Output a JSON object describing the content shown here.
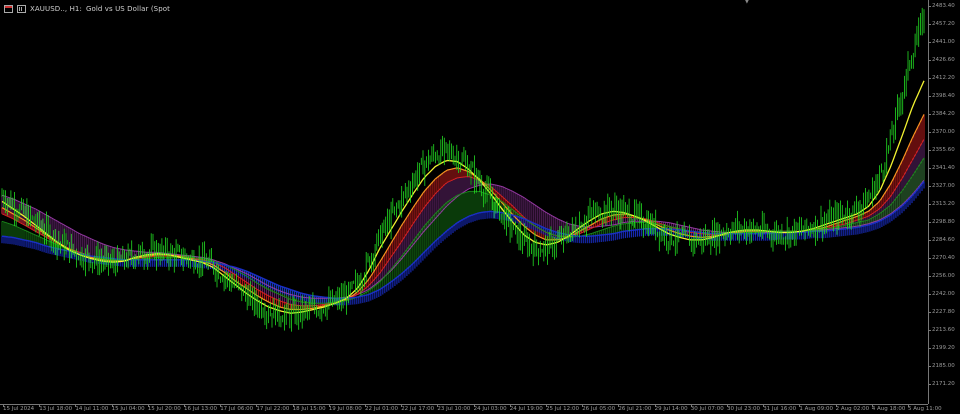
{
  "title": {
    "symbol": "XAUUSD.., H1:",
    "description": "Gold vs US Dollar (Spot"
  },
  "icons": {
    "window": "window-menu-icon",
    "chart_type": "bar-chart-icon",
    "corner": "triangle-marker-icon"
  },
  "colors": {
    "background": "#000000",
    "candles": "#22dd22",
    "ma_fast": "#ffff33",
    "ma_orange": "#ff9922",
    "ma_red": "#dd2222",
    "ma_green": "#1a8a1a",
    "ma_blue": "#1a2fcc",
    "ma_purple": "#9a3aa8"
  },
  "price_axis": {
    "labels": [
      "2483.40",
      "2457.20",
      "2441.00",
      "2426.60",
      "2412.20",
      "2398.40",
      "2384.20",
      "2370.00",
      "2355.60",
      "2341.40",
      "2327.00",
      "2313.20",
      "2298.80",
      "2284.60",
      "2270.40",
      "2256.00",
      "2242.00",
      "2227.80",
      "2213.60",
      "2199.20",
      "2185.00",
      "2171.20"
    ]
  },
  "time_axis": {
    "labels": [
      "15 Jul 2024",
      "13 Jul 18:00",
      "14 Jul 11:00",
      "15 Jul 04:00",
      "15 Jul 20:00",
      "16 Jul 13:00",
      "17 Jul 06:00",
      "17 Jul 22:00",
      "18 Jul 15:00",
      "19 Jul 08:00",
      "22 Jul 01:00",
      "22 Jul 17:00",
      "23 Jul 10:00",
      "24 Jul 03:00",
      "24 Jul 19:00",
      "25 Jul 12:00",
      "26 Jul 05:00",
      "26 Jul 21:00",
      "29 Jul 14:00",
      "30 Jul 07:00",
      "30 Jul 23:00",
      "31 Jul 16:00",
      "1 Aug 09:00",
      "2 Aug 02:00",
      "4 Aug 18:00",
      "5 Aug 11:00"
    ]
  },
  "chart_data": {
    "type": "line",
    "series": [
      {
        "key": "price",
        "values": [
          2333,
          2325,
          2318,
          2311,
          2304,
          2296,
          2290,
          2285,
          2282,
          2280,
          2278,
          2281,
          2285,
          2287,
          2288,
          2286,
          2284,
          2282,
          2280,
          2276,
          2268,
          2260,
          2252,
          2245,
          2240,
          2237,
          2236,
          2238,
          2241,
          2244,
          2247,
          2252,
          2262,
          2280,
          2300,
          2315,
          2330,
          2345,
          2358,
          2366,
          2368,
          2364,
          2355,
          2343,
          2330,
          2317,
          2305,
          2295,
          2290,
          2291,
          2295,
          2302,
          2310,
          2317,
          2321,
          2322,
          2320,
          2316,
          2311,
          2305,
          2300,
          2297,
          2296,
          2297,
          2300,
          2304,
          2306,
          2306,
          2305,
          2303,
          2302,
          2303,
          2305,
          2308,
          2312,
          2315,
          2318,
          2322,
          2330,
          2348,
          2378,
          2415,
          2450,
          2476
        ]
      },
      {
        "key": "ma_fast",
        "values": [
          2328,
          2322,
          2316,
          2309,
          2302,
          2295,
          2289,
          2285,
          2282,
          2280,
          2279,
          2280,
          2283,
          2285,
          2286,
          2285,
          2283,
          2281,
          2279,
          2275,
          2268,
          2261,
          2254,
          2248,
          2243,
          2240,
          2238,
          2239,
          2241,
          2243,
          2246,
          2250,
          2258,
          2272,
          2290,
          2305,
          2320,
          2334,
          2347,
          2356,
          2361,
          2360,
          2354,
          2345,
          2334,
          2322,
          2311,
          2301,
          2295,
          2293,
          2295,
          2300,
          2307,
          2313,
          2318,
          2320,
          2319,
          2316,
          2312,
          2307,
          2302,
          2299,
          2297,
          2297,
          2299,
          2302,
          2304,
          2305,
          2305,
          2304,
          2303,
          2303,
          2304,
          2306,
          2309,
          2312,
          2315,
          2318,
          2324,
          2336,
          2356,
          2380,
          2405,
          2425
        ]
      },
      {
        "key": "ma_orange",
        "values": [
          2323,
          2318,
          2313,
          2307,
          2301,
          2295,
          2290,
          2286,
          2283,
          2281,
          2280,
          2280,
          2282,
          2284,
          2285,
          2285,
          2284,
          2282,
          2280,
          2277,
          2271,
          2264,
          2258,
          2252,
          2247,
          2243,
          2241,
          2241,
          2242,
          2244,
          2246,
          2249,
          2255,
          2265,
          2279,
          2294,
          2309,
          2323,
          2336,
          2346,
          2353,
          2355,
          2352,
          2346,
          2337,
          2327,
          2317,
          2308,
          2301,
          2297,
          2297,
          2299,
          2304,
          2309,
          2314,
          2317,
          2318,
          2316,
          2313,
          2309,
          2305,
          2302,
          2300,
          2299,
          2300,
          2301,
          2303,
          2304,
          2304,
          2304,
          2303,
          2303,
          2304,
          2305,
          2307,
          2310,
          2313,
          2316,
          2320,
          2328,
          2342,
          2360,
          2380,
          2398
        ]
      },
      {
        "key": "ma_red",
        "values": [
          2318,
          2314,
          2309,
          2304,
          2299,
          2294,
          2290,
          2287,
          2284,
          2282,
          2281,
          2281,
          2282,
          2283,
          2284,
          2284,
          2284,
          2283,
          2281,
          2279,
          2275,
          2269,
          2263,
          2257,
          2252,
          2248,
          2245,
          2244,
          2244,
          2245,
          2247,
          2249,
          2253,
          2260,
          2270,
          2283,
          2296,
          2310,
          2323,
          2334,
          2343,
          2347,
          2348,
          2345,
          2340,
          2332,
          2324,
          2315,
          2308,
          2303,
          2300,
          2300,
          2302,
          2306,
          2310,
          2313,
          2315,
          2315,
          2314,
          2311,
          2308,
          2305,
          2303,
          2302,
          2301,
          2302,
          2303,
          2304,
          2304,
          2304,
          2304,
          2304,
          2304,
          2305,
          2306,
          2308,
          2310,
          2313,
          2316,
          2322,
          2332,
          2346,
          2362,
          2378
        ]
      },
      {
        "key": "ma_green",
        "values": [
          2312,
          2309,
          2305,
          2301,
          2297,
          2293,
          2289,
          2286,
          2284,
          2282,
          2281,
          2281,
          2281,
          2282,
          2283,
          2283,
          2283,
          2283,
          2282,
          2280,
          2277,
          2273,
          2268,
          2262,
          2257,
          2253,
          2249,
          2247,
          2246,
          2246,
          2247,
          2248,
          2251,
          2256,
          2263,
          2273,
          2284,
          2296,
          2308,
          2318,
          2327,
          2333,
          2336,
          2336,
          2333,
          2328,
          2321,
          2314,
          2308,
          2303,
          2300,
          2299,
          2300,
          2302,
          2305,
          2308,
          2310,
          2311,
          2311,
          2310,
          2308,
          2306,
          2304,
          2303,
          2302,
          2302,
          2302,
          2303,
          2303,
          2304,
          2304,
          2304,
          2304,
          2305,
          2306,
          2307,
          2309,
          2311,
          2313,
          2318,
          2325,
          2336,
          2349,
          2363
        ]
      },
      {
        "key": "ma_blue",
        "values": [
          2300,
          2299,
          2297,
          2295,
          2292,
          2290,
          2288,
          2286,
          2284,
          2283,
          2282,
          2281,
          2281,
          2281,
          2281,
          2281,
          2281,
          2281,
          2280,
          2279,
          2277,
          2275,
          2272,
          2268,
          2264,
          2260,
          2257,
          2254,
          2252,
          2251,
          2250,
          2250,
          2251,
          2253,
          2257,
          2263,
          2270,
          2278,
          2287,
          2296,
          2304,
          2311,
          2316,
          2319,
          2320,
          2319,
          2317,
          2314,
          2310,
          2306,
          2303,
          2301,
          2300,
          2300,
          2301,
          2302,
          2304,
          2305,
          2306,
          2306,
          2306,
          2305,
          2304,
          2303,
          2302,
          2302,
          2302,
          2302,
          2302,
          2302,
          2303,
          2303,
          2303,
          2304,
          2304,
          2305,
          2306,
          2307,
          2309,
          2312,
          2317,
          2324,
          2333,
          2344
        ]
      },
      {
        "key": "ma_purple",
        "values": [
          2333,
          2330,
          2326,
          2322,
          2317,
          2312,
          2307,
          2302,
          2298,
          2294,
          2291,
          2289,
          2288,
          2287,
          2287,
          2286,
          2285,
          2284,
          2283,
          2281,
          2278,
          2274,
          2270,
          2265,
          2260,
          2256,
          2253,
          2251,
          2250,
          2250,
          2250,
          2251,
          2253,
          2257,
          2264,
          2272,
          2282,
          2293,
          2304,
          2314,
          2324,
          2332,
          2338,
          2341,
          2342,
          2340,
          2336,
          2331,
          2325,
          2319,
          2314,
          2310,
          2308,
          2307,
          2308,
          2309,
          2311,
          2312,
          2312,
          2312,
          2311,
          2309,
          2307,
          2305,
          2304,
          2303,
          2303,
          2303,
          2303,
          2303,
          2304,
          2304,
          2304,
          2305,
          2305,
          2306,
          2307,
          2308,
          2310,
          2313,
          2318,
          2325,
          2334,
          2345
        ]
      }
    ],
    "ylim": [
      2165,
      2490
    ],
    "grid": false,
    "legend": "none"
  }
}
